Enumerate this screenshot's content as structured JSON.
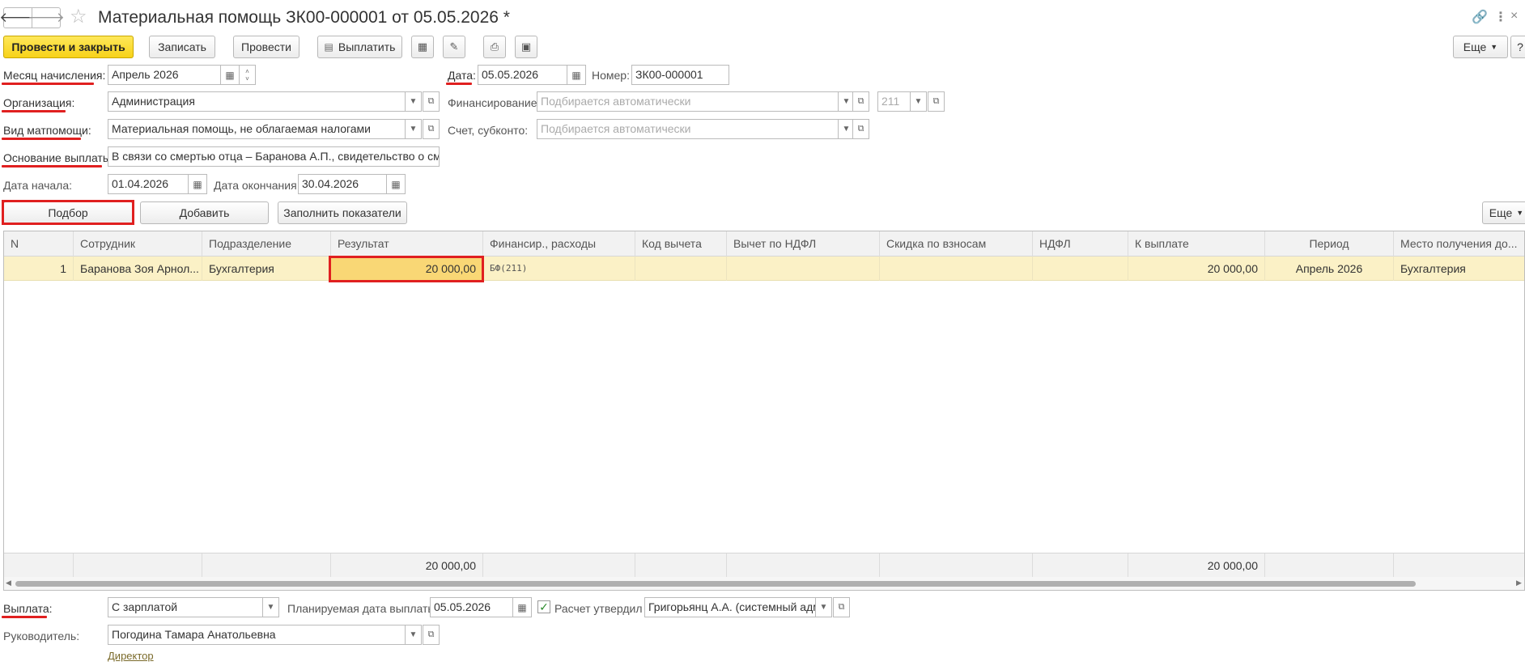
{
  "header": {
    "title": "Материальная помощь ЗК00-000001 от 05.05.2026 *",
    "back_icon": "arrow-left-icon",
    "forward_icon": "arrow-right-icon",
    "star_icon": "star-icon",
    "link_icon": "link-icon",
    "menu_icon": "more-vertical-icon",
    "close_icon": "close-icon"
  },
  "toolbar": {
    "post_and_close": "Провести и закрыть",
    "save": "Записать",
    "post": "Провести",
    "pay": "Выплатить",
    "more": "Еще",
    "help": "?"
  },
  "form": {
    "accrual_month_label": "Месяц начисления:",
    "accrual_month_value": "Апрель 2026",
    "date_label": "Дата:",
    "date_value": "05.05.2026",
    "number_label": "Номер:",
    "number_value": "ЗК00-000001",
    "organization_label": "Организация:",
    "organization_value": "Администрация",
    "financing_label": "Финансирование:",
    "financing_placeholder": "Подбирается автоматически",
    "financing_code": "211",
    "aid_type_label": "Вид матпомощи:",
    "aid_type_value": "Материальная помощь, не облагаемая налогами",
    "account_label": "Счет, субконто:",
    "account_placeholder": "Подбирается автоматически",
    "basis_label": "Основание выплаты:",
    "basis_value": "В связи со смертью отца – Баранова А.П., свидетельство о смерти",
    "start_date_label": "Дата начала:",
    "start_date_value": "01.04.2026",
    "end_date_label": "Дата окончания:",
    "end_date_value": "30.04.2026"
  },
  "table_toolbar": {
    "pick": "Подбор",
    "add": "Добавить",
    "fill_indicators": "Заполнить показатели",
    "more": "Еще"
  },
  "table": {
    "columns": [
      "N",
      "Сотрудник",
      "Подразделение",
      "Результат",
      "Финансир., расходы",
      "Код вычета",
      "Вычет по НДФЛ",
      "Скидка по взносам",
      "НДФЛ",
      "К выплате",
      "Период",
      "Место получения до..."
    ],
    "rows": [
      {
        "n": "1",
        "employee": "Баранова Зоя Арнол...",
        "department": "Бухгалтерия",
        "result": "20 000,00",
        "financing": "БФ(211)",
        "deduction_code": "",
        "ndfl_deduction": "",
        "contrib_discount": "",
        "ndfl": "",
        "to_pay": "20 000,00",
        "period": "Апрель 2026",
        "place": "Бухгалтерия"
      }
    ],
    "totals": {
      "result": "20 000,00",
      "to_pay": "20 000,00"
    }
  },
  "footer": {
    "payment_label": "Выплата:",
    "payment_value": "С зарплатой",
    "planned_date_label": "Планируемая дата выплаты:",
    "planned_date_value": "05.05.2026",
    "approved_label": "Расчет утвердил",
    "approved_by": "Григорьянц А.А. (системный администратор)",
    "manager_label": "Руководитель:",
    "manager_value": "Погодина Тамара Анатольевна",
    "manager_position_link": "Директор"
  }
}
